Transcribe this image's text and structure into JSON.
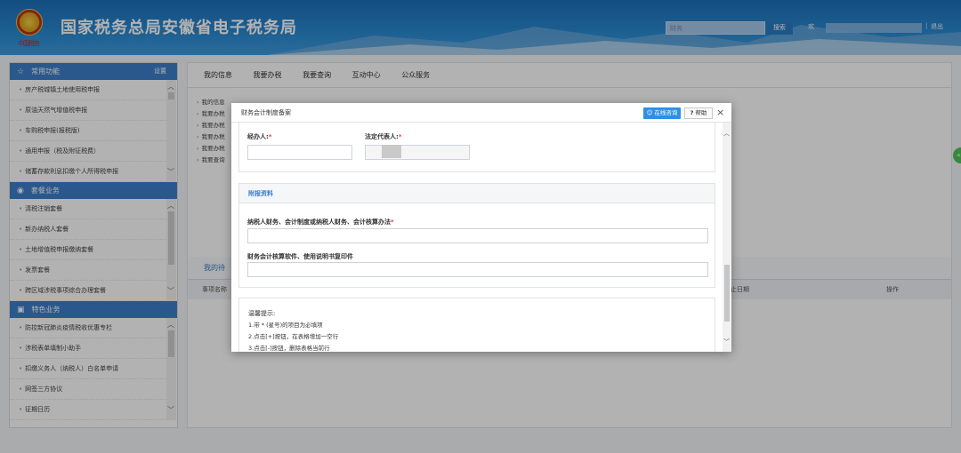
{
  "header": {
    "title": "国家税务总局安徽省电子税务局",
    "emblem_text": "中国税务",
    "search_placeholder": "财务",
    "search_button": "搜索",
    "welcome": "欢",
    "separator": "|",
    "logout": "退出",
    "colors": {
      "top": "#1d6fb8",
      "bottom": "#3b9be0"
    }
  },
  "sidebar": {
    "sections": [
      {
        "title": "常用功能",
        "icon": "star-icon",
        "action": "设置",
        "items": [
          "房产税城镇土地使用税申报",
          "原油天然气增值税申报",
          "车购税申报(报税版)",
          "通用申报（税及附征税费）",
          "储蓄存款利息扣缴个人所得税申报"
        ]
      },
      {
        "title": "套餐业务",
        "icon": "bundle-icon",
        "items": [
          "清税注销套餐",
          "新办纳税人套餐",
          "土地增值税申报缴纳套餐",
          "发票套餐",
          "跨区域涉税事项综合办理套餐"
        ]
      },
      {
        "title": "特色业务",
        "icon": "grid-icon",
        "items": [
          "防控新冠肺炎疫情税收优惠专栏",
          "涉税表单填制小助手",
          "扣缴义务人（纳税人）白名单申请",
          "网签三方协议",
          "征期日历"
        ]
      }
    ]
  },
  "main": {
    "tabs": [
      "我的信息",
      "我要办税",
      "我要查询",
      "互动中心",
      "公众服务"
    ],
    "quick_links": [
      "我的信息",
      "我要办税",
      "我要办税",
      "我要办税",
      "我要办税",
      "我要查询"
    ],
    "todo": {
      "tab": "我的待",
      "columns": [
        "事项名称",
        "止日期",
        "操作"
      ]
    }
  },
  "modal": {
    "title": "财务会计制度备案",
    "service_button": "在线咨询",
    "help_button": "帮助",
    "close": "×",
    "section1": {
      "agent_label": "经办人:",
      "legal_label": "法定代表人:",
      "required_mark": "*"
    },
    "section2": {
      "title": "附报资料",
      "field1_label": "纳税人财务、会计制度或纳税人财务、会计核算办法",
      "field2_label": "财务会计核算软件、使用说明书复印件"
    },
    "tips": {
      "title": "温馨提示:",
      "lines": [
        "1.带 * (星号)的项目为必填项",
        "2.点击[+]按钮，在表格增加一空行",
        "3.点击[-]按钮，删除表格当前行"
      ]
    }
  }
}
